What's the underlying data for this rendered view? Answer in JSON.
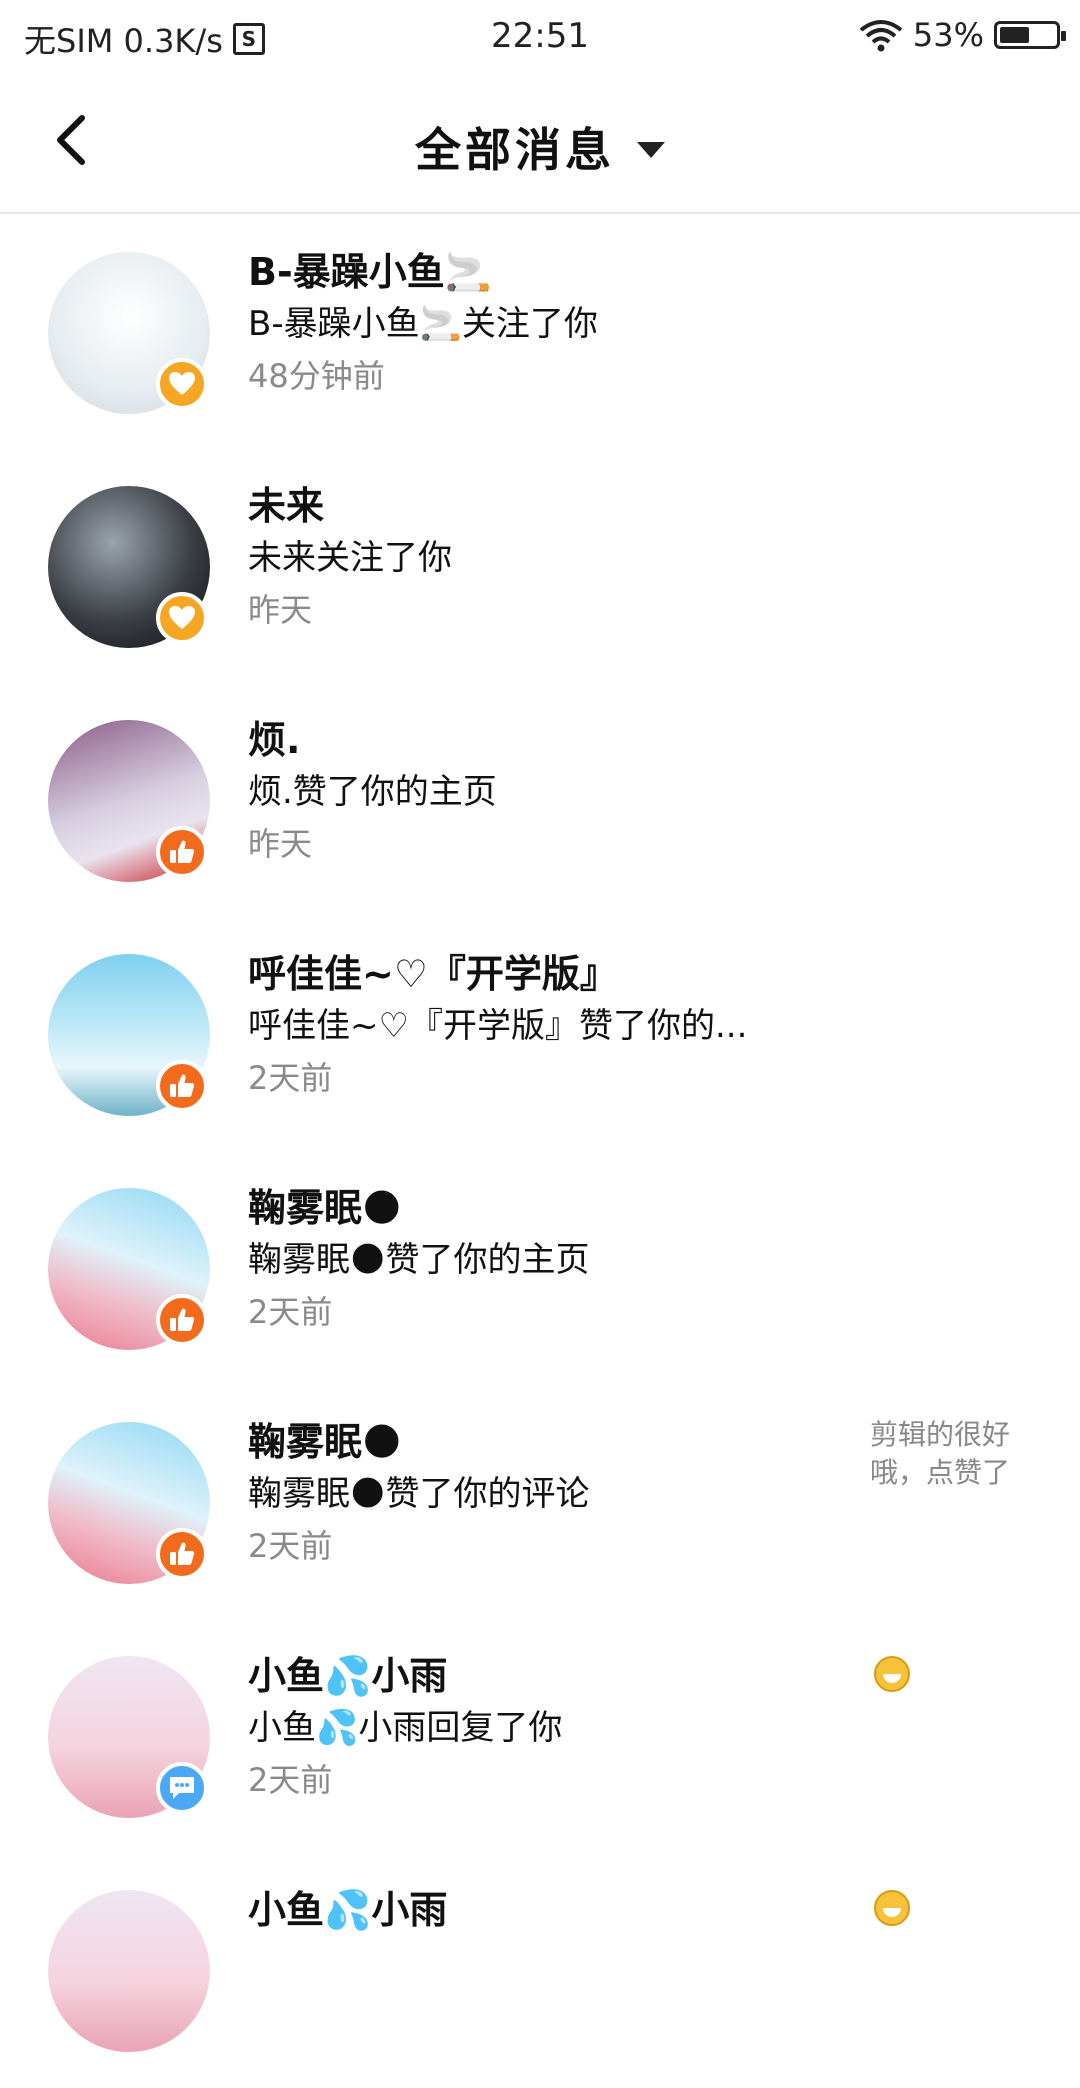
{
  "status": {
    "carrier": "无SIM 0.3K/s",
    "sim_icon_text": "S",
    "time": "22:51",
    "battery": "53%",
    "battery_level": 0.53
  },
  "header": {
    "title": "全部消息"
  },
  "items": [
    {
      "name": "B-暴躁小鱼🚬",
      "desc": "B-暴躁小鱼🚬关注了你",
      "time": "48分钟前",
      "badge": "follow"
    },
    {
      "name": "未来",
      "desc": "未来关注了你",
      "time": "昨天",
      "badge": "follow"
    },
    {
      "name": "烦.",
      "desc": "烦.赞了你的主页",
      "time": "昨天",
      "badge": "like"
    },
    {
      "name": "呼佳佳~♡『开学版』",
      "desc": "呼佳佳~♡『开学版』赞了你的...",
      "time": "2天前",
      "badge": "like"
    },
    {
      "name": "鞠雾眠🌑",
      "desc": "鞠雾眠🌑赞了你的主页",
      "time": "2天前",
      "badge": "like"
    },
    {
      "name": "鞠雾眠🌑",
      "desc": "鞠雾眠🌑赞了你的评论",
      "time": "2天前",
      "badge": "like",
      "snippet": "剪辑的很好哦，点赞了"
    },
    {
      "name": "小鱼💦小雨",
      "desc": "小鱼💦小雨回复了你",
      "time": "2天前",
      "badge": "reply",
      "emoji": "grin-emoji"
    },
    {
      "name": "小鱼💦小雨",
      "desc": "",
      "time": "",
      "badge": "",
      "emoji": "sweat-smile-emoji"
    }
  ],
  "colors": {
    "follow_badge": "#f5a623",
    "like_badge": "#f26a1b",
    "reply_badge": "#4aa8f5",
    "time_text": "#8a8a8a"
  }
}
